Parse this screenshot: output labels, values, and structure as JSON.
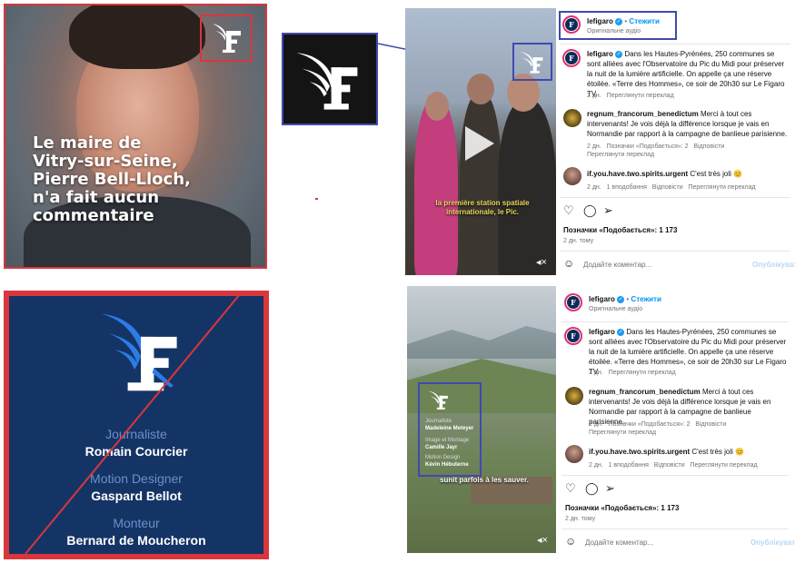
{
  "photo_panel": {
    "caption": [
      "Le maire de",
      "Vitry-sur-Seine,",
      "Pierre Bell-Lloch,",
      "n'a fait aucun",
      "commentaire"
    ]
  },
  "credits_panel": {
    "background": "#153466",
    "credits": [
      {
        "role": "Journaliste",
        "name": "Romain Courcier"
      },
      {
        "role": "Motion Designer",
        "name": "Gaspard Bellot"
      },
      {
        "role": "Monteur",
        "name": "Bernard de Moucheron"
      }
    ]
  },
  "logo": {
    "icon": "le-figaro-logo-icon",
    "letter": "F"
  },
  "posts": [
    {
      "username": "lefigaro",
      "follow_label": "Стежити",
      "audio": "Оригінальне аудіо",
      "video_subtitle": [
        "la première station spatiale",
        "internationale, le Pic."
      ],
      "caption_user": "lefigaro",
      "caption": "Dans les Hautes-Pyrénées, 250 communes se sont alliées avec l'Observatoire du Pic du Midi pour préserver la nuit de la lumière artificielle. On appelle ça une réserve étoilée. «Terre des Hommes», ce soir de 20h30 sur Le Figaro TV.",
      "caption_meta": {
        "time": "2 дн.",
        "action": "Переглянути переклад"
      },
      "comments": [
        {
          "user": "regnum_francorum_benedictum",
          "text": "Merci à tout ces intervenants! Je vois déjà la différence lorsque je vais en Normandie par rapport à la campagne de banlieue parisienne.",
          "time": "2 дн.",
          "likes": "Позначки «Подобається»: 2",
          "reply": "Відповісти",
          "translate": "Переглянути переклад"
        },
        {
          "user": "if.you.have.two.spirits.urgent",
          "text": "C'est très joli 😊",
          "time": "2 дн.",
          "likes": "1 вподобання",
          "reply": "Відповісти",
          "translate": "Переглянути переклад"
        }
      ],
      "likes": "Позначки «Подобається»: 1 173",
      "date": "2 дн. тому",
      "comment_placeholder": "Додайте коментар...",
      "post_label": "Опублікувати"
    },
    {
      "username": "lefigaro",
      "follow_label": "Стежити",
      "audio": "Оригінальне аудіо",
      "video_subtitle": [
        "sunit parfois à les sauver."
      ],
      "video_credits": [
        {
          "role": "Journaliste",
          "name": "Madeleine Meteyer"
        },
        {
          "role": "Image et Montage",
          "name": "Camille Jayr"
        },
        {
          "role": "Motion Design",
          "name": "Kévin Hébuterne"
        }
      ],
      "caption_user": "lefigaro",
      "caption": "Dans les Hautes-Pyrénées, 250 communes se sont alliées avec l'Observatoire du Pic du Midi pour préserver la nuit de la lumière artificielle. On appelle ça une réserve étoilée. «Terre des Hommes», ce soir de 20h30 sur Le Figaro TV.",
      "caption_meta": {
        "time": "2 дн.",
        "action": "Переглянути переклад"
      },
      "comments": [
        {
          "user": "regnum_francorum_benedictum",
          "text": "Merci à tout ces intervenants! Je vois déjà la différence lorsque je vais en Normandie par rapport à la campagne de banlieue parisienne.",
          "time": "2 дн.",
          "likes": "Позначки «Подобається»: 2",
          "reply": "Відповісти",
          "translate": "Переглянути переклад"
        },
        {
          "user": "if.you.have.two.spirits.urgent",
          "text": "C'est très joli 😊",
          "time": "2 дн.",
          "likes": "1 вподобання",
          "reply": "Відповісти",
          "translate": "Переглянути переклад"
        }
      ],
      "likes": "Позначки «Подобається»: 1 173",
      "date": "2 дн. тому",
      "comment_placeholder": "Додайте коментар...",
      "post_label": "Опублікувати"
    }
  ],
  "colors": {
    "highlight_red": "#d9363e",
    "highlight_blue": "#3f4ab0",
    "instagram_blue": "#0095f6"
  }
}
